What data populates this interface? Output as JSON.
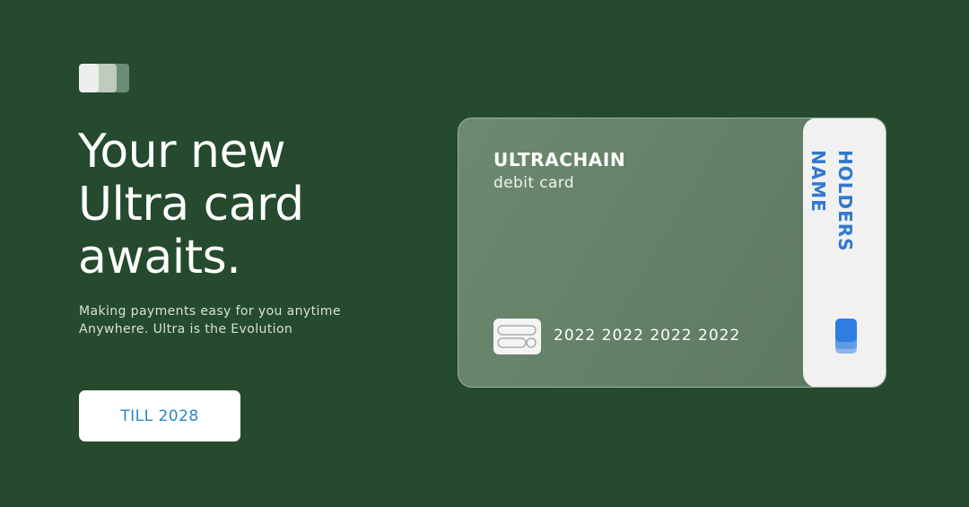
{
  "headline": {
    "line1": "Your new",
    "line2": "Ultra card",
    "line3": "awaits."
  },
  "subtext": {
    "line1": "Making payments easy for you anytime",
    "line2": "Anywhere. Ultra is the Evolution"
  },
  "cta": {
    "label": "TILL 2028"
  },
  "card": {
    "brand": "ULTRACHAIN",
    "type": "debit card",
    "number": "2022 2022 2022 2022",
    "holder_name": "HOLDERS\nNAME"
  },
  "icons": {
    "logo": "card-stack-logo",
    "chip": "card-chip-icon",
    "stack": "layers-icon"
  },
  "colors": {
    "background": "#254a2e",
    "card": "#657f68",
    "accent": "#2a86c7",
    "holder_text": "#3178cf"
  }
}
